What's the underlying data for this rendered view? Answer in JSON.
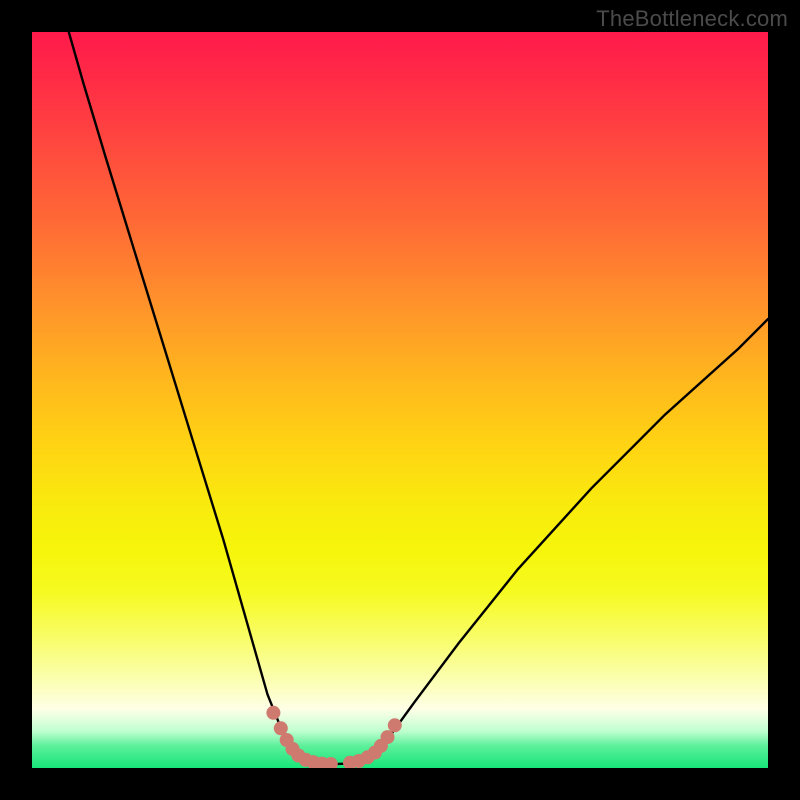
{
  "attribution": "TheBottleneck.com",
  "colors": {
    "frame": "#000000",
    "curve": "#000000",
    "markers": "#cf7a6e",
    "gradient_top": "#ff1a4b",
    "gradient_mid": "#f9ea0e",
    "gradient_bottom": "#17e57a"
  },
  "chart_data": {
    "type": "line",
    "title": "",
    "xlabel": "",
    "ylabel": "",
    "xlim": [
      0,
      100
    ],
    "ylim": [
      0,
      100
    ],
    "grid": false,
    "legend": false,
    "series": [
      {
        "name": "left-branch",
        "x": [
          5,
          7,
          10,
          14,
          18,
          22,
          26,
          30,
          32,
          34,
          35,
          36,
          37
        ],
        "y": [
          100,
          93,
          83,
          70,
          57,
          44,
          31,
          17,
          10,
          5,
          3,
          1.5,
          0.8
        ]
      },
      {
        "name": "valley-floor",
        "x": [
          37,
          40,
          43,
          46
        ],
        "y": [
          0.8,
          0.5,
          0.6,
          1.2
        ]
      },
      {
        "name": "right-branch",
        "x": [
          46,
          48,
          52,
          58,
          66,
          76,
          86,
          96,
          100
        ],
        "y": [
          1.2,
          3.5,
          9,
          17,
          27,
          38,
          48,
          57,
          61
        ]
      }
    ],
    "markers": [
      {
        "name": "left-cluster",
        "x": [
          32.8,
          33.8,
          34.6,
          35.4,
          36.2,
          37.2,
          38.2,
          39.4,
          40.6
        ],
        "y": [
          7.5,
          5.4,
          3.8,
          2.6,
          1.7,
          1.1,
          0.8,
          0.6,
          0.55
        ]
      },
      {
        "name": "right-cluster",
        "x": [
          43.2,
          44.4,
          45.6,
          46.6,
          47.4,
          48.3,
          49.3
        ],
        "y": [
          0.7,
          0.95,
          1.45,
          2.1,
          3.0,
          4.2,
          5.8
        ]
      }
    ],
    "note": "V-shaped bottleneck curve on a heat-gradient background; y=0 (green) at bottom is optimum, y=100 (red) at top is worst. Minimum sits near x≈40 on the x-axis."
  }
}
